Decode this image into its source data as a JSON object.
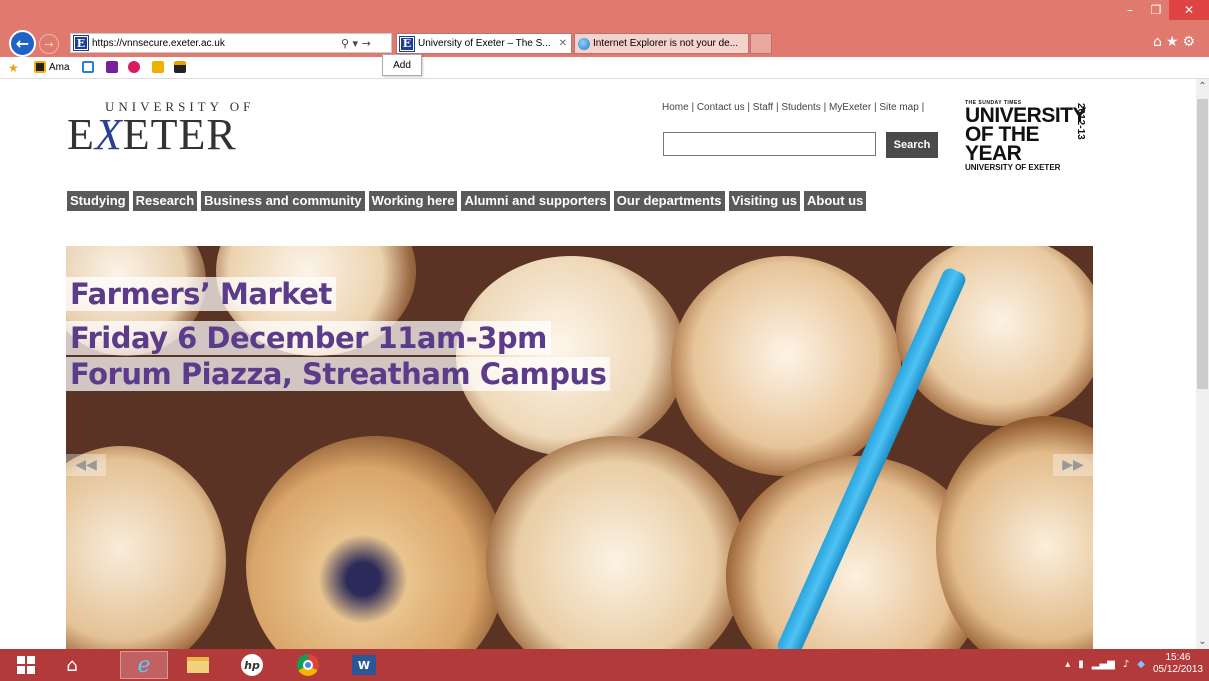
{
  "browser": {
    "url": "https://vnnsecure.exeter.ac.uk",
    "tabs": [
      {
        "label": "University of Exeter – The S..."
      },
      {
        "label": "Internet Explorer is not your de..."
      }
    ],
    "favorites_label": "Ama",
    "add_label": "Add"
  },
  "site": {
    "logo_top": "UNIVERSITY OF",
    "logo_main_pre": "E",
    "logo_main_x": "X",
    "logo_main_post": "ETER",
    "toplinks": "Home | Contact us | Staff | Students | MyExeter | Site map |",
    "search_label": "Search",
    "award": {
      "small": "THE SUNDAY TIMES",
      "line1": "UNIVERSITY",
      "line2": "OF THE YEAR",
      "year": "2012-13",
      "foot": "UNIVERSITY OF EXETER"
    },
    "nav": [
      "Studying",
      "Research",
      "Business and community",
      "Working here",
      "Alumni and supporters",
      "Our departments",
      "Visiting us",
      "About us"
    ],
    "hero": {
      "line1": "Farmers’ Market",
      "line2": "Friday 6 December 11am-3pm",
      "line3": "Forum Piazza, Streatham Campus"
    }
  },
  "taskbar": {
    "time": "15:46",
    "date": "05/12/2013"
  }
}
